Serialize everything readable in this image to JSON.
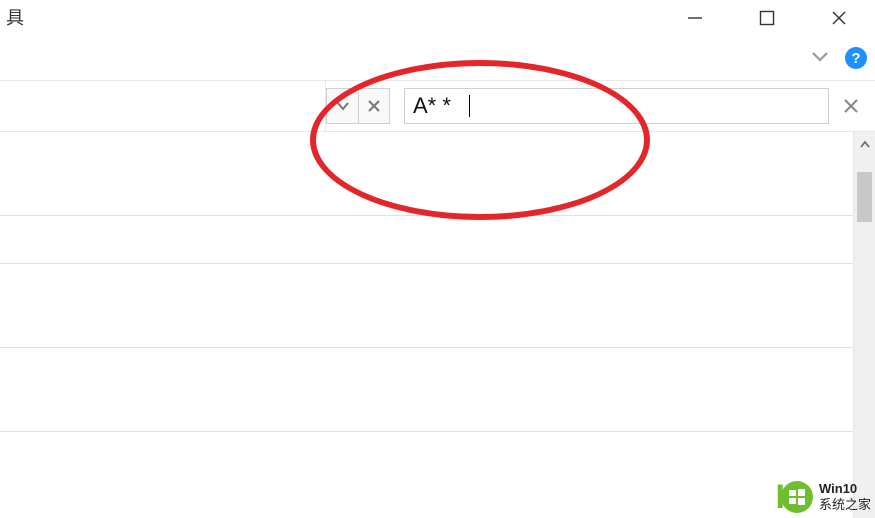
{
  "truncated_char": "具",
  "search": {
    "value": "A* *"
  },
  "watermark": {
    "line1": "Win10",
    "line2": "系统之家"
  },
  "help": {
    "label": "?"
  }
}
